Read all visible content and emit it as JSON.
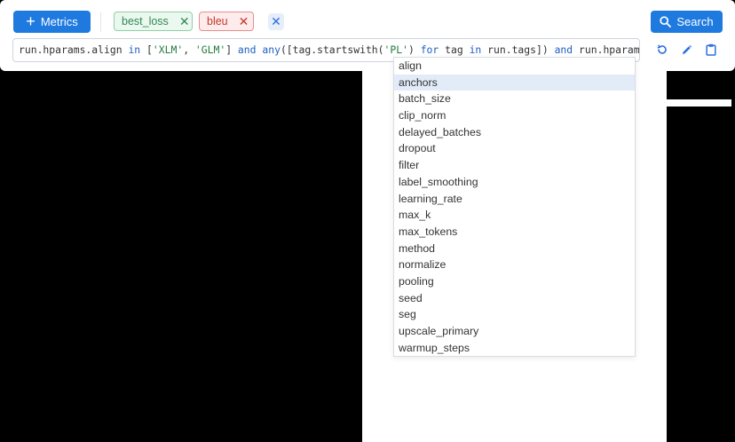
{
  "toolbar": {
    "metrics_label": "Metrics",
    "search_label": "Search",
    "chips": [
      {
        "label": "best_loss",
        "color": "green"
      },
      {
        "label": "bleu",
        "color": "red"
      }
    ]
  },
  "query": {
    "parts": [
      {
        "t": "run.hparams.align ",
        "c": "plain"
      },
      {
        "t": "in",
        "c": "kw"
      },
      {
        "t": " [",
        "c": "plain"
      },
      {
        "t": "'XLM'",
        "c": "str"
      },
      {
        "t": ", ",
        "c": "plain"
      },
      {
        "t": "'GLM'",
        "c": "str"
      },
      {
        "t": "] ",
        "c": "plain"
      },
      {
        "t": "and",
        "c": "kw"
      },
      {
        "t": " ",
        "c": "plain"
      },
      {
        "t": "any",
        "c": "kw"
      },
      {
        "t": "([tag.startswith(",
        "c": "plain"
      },
      {
        "t": "'PL'",
        "c": "str"
      },
      {
        "t": ") ",
        "c": "plain"
      },
      {
        "t": "for",
        "c": "kw"
      },
      {
        "t": " tag ",
        "c": "plain"
      },
      {
        "t": "in",
        "c": "kw"
      },
      {
        "t": " run.tags]) ",
        "c": "plain"
      },
      {
        "t": "and",
        "c": "kw"
      },
      {
        "t": " run.hparams.",
        "c": "plain"
      }
    ]
  },
  "autocomplete": {
    "items": [
      "align",
      "anchors",
      "batch_size",
      "clip_norm",
      "delayed_batches",
      "dropout",
      "filter",
      "label_smoothing",
      "learning_rate",
      "max_k",
      "max_tokens",
      "method",
      "normalize",
      "pooling",
      "seed",
      "seg",
      "upscale_primary",
      "warmup_steps"
    ],
    "active_index": 1
  },
  "icons": [
    "plus-icon",
    "close-icon",
    "search-icon",
    "reset-icon",
    "edit-icon",
    "copy-icon"
  ],
  "colors": {
    "accent": "#1f7ae0"
  }
}
